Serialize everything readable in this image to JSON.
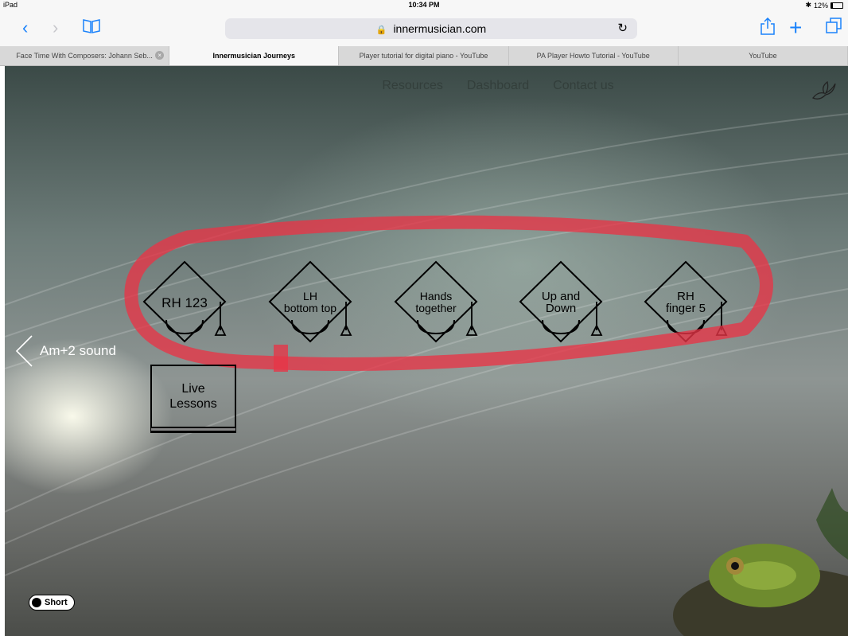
{
  "statusbar": {
    "device": "iPad",
    "time": "10:34 PM",
    "battery": "12%"
  },
  "toolbar": {
    "url": "innermusician.com"
  },
  "tabs": [
    {
      "label": "Face Time With Composers: Johann Seb...",
      "active": false,
      "closable": true
    },
    {
      "label": "Innermusician Journeys",
      "active": true,
      "closable": false
    },
    {
      "label": "Player tutorial for digital piano - YouTube",
      "active": false,
      "closable": false
    },
    {
      "label": "PA Player Howto Tutorial - YouTube",
      "active": false,
      "closable": false
    },
    {
      "label": "YouTube",
      "active": false,
      "closable": false
    }
  ],
  "site_nav": [
    "Dashboard",
    "Contact us"
  ],
  "site_nav_partial": "Resources",
  "lessons": [
    {
      "label": "RH 123"
    },
    {
      "label": "LH\nbottom top"
    },
    {
      "label": "Hands\ntogether"
    },
    {
      "label": "Up and\nDown"
    },
    {
      "label": "RH\nfinger 5"
    }
  ],
  "live_lessons": "Live\nLessons",
  "prev_link": "Am+2 sound",
  "toggle": {
    "label": "Short"
  },
  "colors": {
    "ios_blue": "#1a82fb",
    "highlight_red": "#e83446"
  }
}
